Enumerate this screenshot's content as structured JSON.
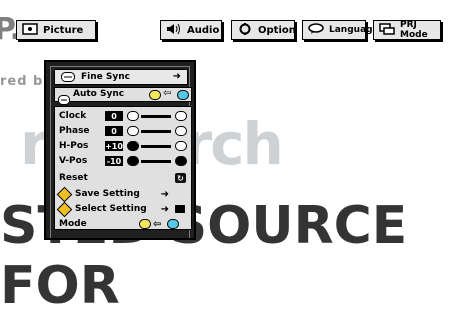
{
  "watermark": {
    "site_fragment": "P.com",
    "subline": "red by",
    "brand_fragment": "rt Merch",
    "tagline_fragment": "STED SOURCE FOR"
  },
  "top_menu": {
    "picture": "Picture",
    "audio": "Audio",
    "option": "Option",
    "language": "Language",
    "prj_mode": "PRJ Mode"
  },
  "panel": {
    "header": "Fine Sync",
    "auto_sync": "Auto Sync",
    "rows": [
      {
        "label": "Clock",
        "value": "0",
        "level": 0.5
      },
      {
        "label": "Phase",
        "value": "0",
        "level": 0.5
      },
      {
        "label": "H-Pos",
        "value": "+10",
        "level": 0.6
      },
      {
        "label": "V-Pos",
        "value": "-10",
        "level": 0.4
      }
    ],
    "reset": "Reset",
    "save_setting": "Save Setting",
    "select_setting": "Select Setting",
    "mode": "Mode"
  },
  "colors": {
    "yellow": "#f4e85a",
    "cyan": "#55c8e8",
    "panel": "#1f1f1f"
  }
}
